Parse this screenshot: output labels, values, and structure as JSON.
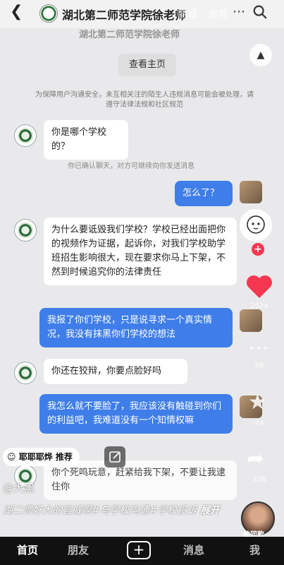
{
  "header": {
    "title": "湖北第二师范学院徐老师",
    "overlay_tabs": [
      "商城",
      "推荐"
    ],
    "subtitle": "湖北第二师范学院徐老师",
    "view_home_label": "查看主页",
    "safety_notice": "为保障用户沟通安全，未互相关注的陌生人违规消息可能会被处理，请遵守法律法规和社区规范"
  },
  "chat": {
    "messages": [
      {
        "side": "left",
        "text": "你是哪个学校的？"
      },
      {
        "side": "notice",
        "text": "你已确认聊天，对方可继续向你发送消息"
      },
      {
        "side": "right",
        "text": "怎么了？"
      },
      {
        "side": "left",
        "text": "为什么要诋毁我们学校？学校已经出面把你的视频作为证据，起诉你，对我们学校助学班招生影响很大，现在要求你马上下架，不然到时候追究你的法律责任"
      },
      {
        "side": "right",
        "text": "我报了你们学校，只是说寻求一个真实情况，我没有抹黑你们学校的想法"
      },
      {
        "side": "left",
        "text": "你还在狡辩，你要点脸好吗"
      },
      {
        "side": "right",
        "text": "我怎么就不要脸了，我应该没有触碰到你们的利益吧，我难道没有一个知情权嘛"
      },
      {
        "side": "left",
        "text": "你个死鸣玩意，赶紧给我下架，不要让我逮住你"
      }
    ]
  },
  "rail": {
    "like_count": "2524",
    "comment_count": "96",
    "favorite_count": "44",
    "share_count": "328"
  },
  "overlay": {
    "ask_chip": "耶耶耶烨 推荐",
    "author": "@大黑",
    "caption": "湖二师好大的官威啊#与学校沟通#学校投诉",
    "expand": "展开",
    "music_label": "拍同款"
  },
  "bottom_nav": {
    "home": "首页",
    "friends": "朋友",
    "plus": "+",
    "messages": "消息",
    "me": "我"
  },
  "colors": {
    "accent_blue": "#3f7ee9",
    "like_red": "#f5364f"
  }
}
